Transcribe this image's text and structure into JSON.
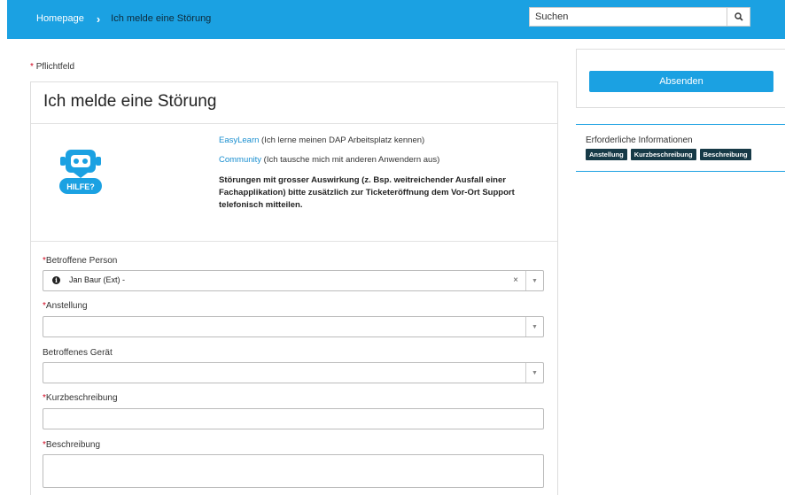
{
  "header": {
    "breadcrumb": {
      "home": "Homepage",
      "separator": "›",
      "current": "Ich melde eine Störung"
    },
    "search": {
      "placeholder": "Suchen"
    }
  },
  "required_note": {
    "marker": "*",
    "text": "Pflichtfeld"
  },
  "form": {
    "title": "Ich melde eine Störung",
    "help_badge_text": "HILFE?",
    "info": {
      "easylearn_link": "EasyLearn",
      "easylearn_text": " (Ich lerne meinen DAP Arbeitsplatz kennen)",
      "community_link": "Community",
      "community_text": " (Ich tausche mich mit anderen Anwendern aus)",
      "notice_line1": "Störungen mit grosser Auswirkung (z. Bsp. weitreichender Ausfall einer",
      "notice_line2": "Fachapplikation) bitte zusätzlich zur Ticketeröffnung dem Vor-Ort Support",
      "notice_line3": "telefonisch mitteilen."
    },
    "fields": {
      "person": {
        "label": "Betroffene Person",
        "value": "Jan Baur (Ext) -",
        "clear": "×",
        "arrow": "▼"
      },
      "anstellung": {
        "label": "Anstellung",
        "arrow": "▼"
      },
      "geraet": {
        "label": "Betroffenes Gerät",
        "arrow": "▼"
      },
      "kurz": {
        "label": "Kurzbeschreibung"
      },
      "beschreibung": {
        "label": "Beschreibung"
      }
    }
  },
  "sidebar": {
    "submit_label": "Absenden",
    "required_info": {
      "title": "Erforderliche Informationen",
      "tags": [
        "Anstellung",
        "Kurzbeschreibung",
        "Beschreibung"
      ]
    }
  },
  "colors": {
    "accent": "#1ba1e2",
    "required_star": "#d0021b",
    "tag_bg": "#173a47",
    "link": "#1a8fd0"
  }
}
